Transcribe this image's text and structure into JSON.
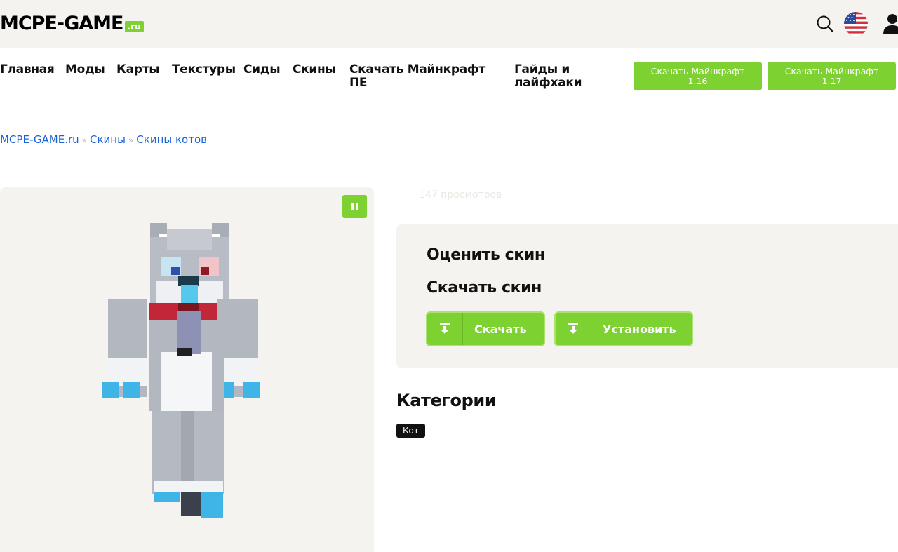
{
  "header": {
    "logo_text": "MCPE-GAME",
    "logo_suffix": ".ru"
  },
  "nav": {
    "items": [
      "Главная",
      "Моды",
      "Карты",
      "Текстуры",
      "Сиды",
      "Скины",
      "Скачать Майнкрафт ПЕ",
      "Гайды и лайфхаки"
    ],
    "buttons": [
      "Скачать Майнкрафт 1.16",
      "Скачать Майнкрафт 1.17"
    ]
  },
  "breadcrumb": {
    "items": [
      "MCPE-GAME.ru",
      "Скины",
      "Скины котов"
    ],
    "separator": "»"
  },
  "skin": {
    "views": "147 просмотров",
    "rate_heading": "Оценить скин",
    "download_heading": "Скачать скин",
    "download_button": "Скачать",
    "install_button": "Установить"
  },
  "categories": {
    "heading": "Категории",
    "tags": [
      "Кот"
    ]
  },
  "colors": {
    "accent": "#7dd130",
    "panel_bg": "#f5f3ef",
    "link": "#1a62d6"
  }
}
